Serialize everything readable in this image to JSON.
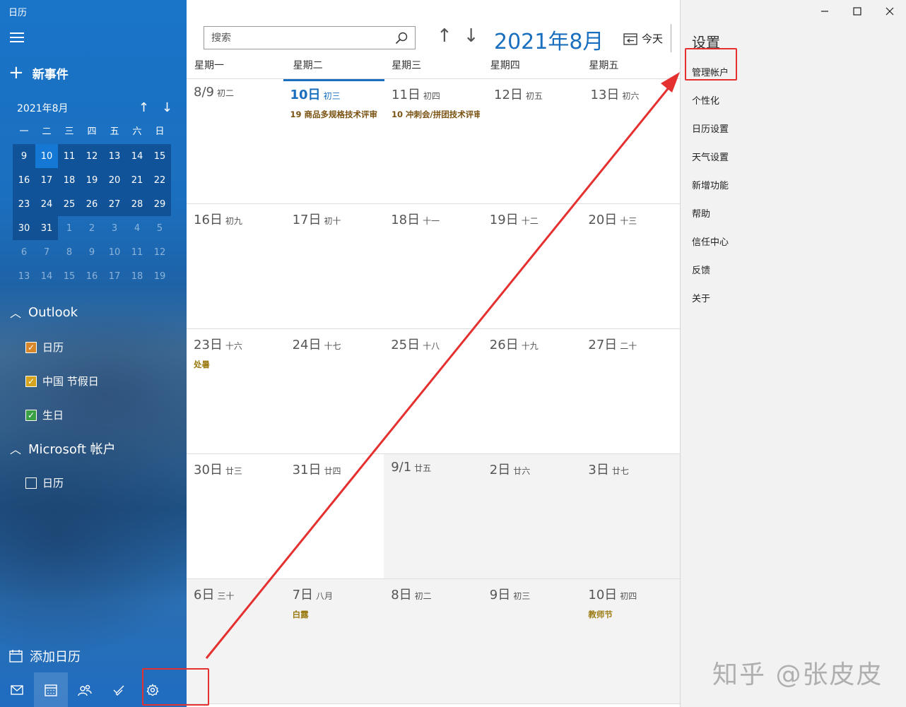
{
  "app": {
    "title": "日历"
  },
  "sidebar": {
    "new_event": "新事件",
    "mini_calendar": {
      "month_label": "2021年8月",
      "dow": [
        "一",
        "二",
        "三",
        "四",
        "五",
        "六",
        "日"
      ],
      "weeks": [
        [
          {
            "d": "9",
            "s": "in"
          },
          {
            "d": "10",
            "s": "today"
          },
          {
            "d": "11",
            "s": "in"
          },
          {
            "d": "12",
            "s": "in"
          },
          {
            "d": "13",
            "s": "in"
          },
          {
            "d": "14",
            "s": "in"
          },
          {
            "d": "15",
            "s": "in"
          }
        ],
        [
          {
            "d": "16",
            "s": "in"
          },
          {
            "d": "17",
            "s": "in"
          },
          {
            "d": "18",
            "s": "in"
          },
          {
            "d": "19",
            "s": "in"
          },
          {
            "d": "20",
            "s": "in"
          },
          {
            "d": "21",
            "s": "in"
          },
          {
            "d": "22",
            "s": "in"
          }
        ],
        [
          {
            "d": "23",
            "s": "in"
          },
          {
            "d": "24",
            "s": "in"
          },
          {
            "d": "25",
            "s": "in"
          },
          {
            "d": "26",
            "s": "in"
          },
          {
            "d": "27",
            "s": "in"
          },
          {
            "d": "28",
            "s": "in"
          },
          {
            "d": "29",
            "s": "in"
          }
        ],
        [
          {
            "d": "30",
            "s": "in"
          },
          {
            "d": "31",
            "s": "in"
          },
          {
            "d": "1",
            "s": "out"
          },
          {
            "d": "2",
            "s": "out"
          },
          {
            "d": "3",
            "s": "out"
          },
          {
            "d": "4",
            "s": "out"
          },
          {
            "d": "5",
            "s": "out"
          }
        ],
        [
          {
            "d": "6",
            "s": "out"
          },
          {
            "d": "7",
            "s": "out"
          },
          {
            "d": "8",
            "s": "out"
          },
          {
            "d": "9",
            "s": "out"
          },
          {
            "d": "10",
            "s": "out"
          },
          {
            "d": "11",
            "s": "out"
          },
          {
            "d": "12",
            "s": "out"
          }
        ],
        [
          {
            "d": "13",
            "s": "out"
          },
          {
            "d": "14",
            "s": "out"
          },
          {
            "d": "15",
            "s": "out"
          },
          {
            "d": "16",
            "s": "out"
          },
          {
            "d": "17",
            "s": "out"
          },
          {
            "d": "18",
            "s": "out"
          },
          {
            "d": "19",
            "s": "out"
          }
        ]
      ]
    },
    "groups": [
      {
        "name": "Outlook",
        "items": [
          {
            "label": "日历",
            "checked": true,
            "color": "orange"
          },
          {
            "label": "中国 节假日",
            "checked": true,
            "color": "yellow"
          },
          {
            "label": "生日",
            "checked": true,
            "color": "green"
          }
        ]
      },
      {
        "name": "Microsoft 帐户",
        "items": [
          {
            "label": "日历",
            "checked": false,
            "color": "none"
          }
        ]
      }
    ],
    "add_calendar": "添加日历",
    "bottom_icons": [
      "mail-icon",
      "calendar-icon",
      "people-icon",
      "todo-icon",
      "settings-icon"
    ]
  },
  "main": {
    "search_placeholder": "搜索",
    "month_title": "2021年8月",
    "today_label": "今天",
    "dow": [
      "星期一",
      "星期二",
      "星期三",
      "星期四",
      "星期五"
    ],
    "weeks": [
      [
        {
          "num": "8/9",
          "lunar": "初二",
          "state": "normal",
          "event": ""
        },
        {
          "num": "10日",
          "lunar": "初三",
          "state": "today",
          "event": "19 商品多规格技术评审"
        },
        {
          "num": "11日",
          "lunar": "初四",
          "state": "normal",
          "event": "10 冲刺会/拼团技术评审"
        },
        {
          "num": "12日",
          "lunar": "初五",
          "state": "normal",
          "event": ""
        },
        {
          "num": "13日",
          "lunar": "初六",
          "state": "normal",
          "event": ""
        }
      ],
      [
        {
          "num": "16日",
          "lunar": "初九",
          "state": "normal",
          "event": ""
        },
        {
          "num": "17日",
          "lunar": "初十",
          "state": "normal",
          "event": ""
        },
        {
          "num": "18日",
          "lunar": "十一",
          "state": "normal",
          "event": ""
        },
        {
          "num": "19日",
          "lunar": "十二",
          "state": "normal",
          "event": ""
        },
        {
          "num": "20日",
          "lunar": "十三",
          "state": "normal",
          "event": ""
        }
      ],
      [
        {
          "num": "23日",
          "lunar": "十六",
          "state": "normal",
          "event": "处暑",
          "holiday": true
        },
        {
          "num": "24日",
          "lunar": "十七",
          "state": "normal",
          "event": ""
        },
        {
          "num": "25日",
          "lunar": "十八",
          "state": "normal",
          "event": ""
        },
        {
          "num": "26日",
          "lunar": "十九",
          "state": "normal",
          "event": ""
        },
        {
          "num": "27日",
          "lunar": "二十",
          "state": "normal",
          "event": ""
        }
      ],
      [
        {
          "num": "30日",
          "lunar": "廿三",
          "state": "normal",
          "event": ""
        },
        {
          "num": "31日",
          "lunar": "廿四",
          "state": "normal",
          "event": ""
        },
        {
          "num": "9/1",
          "lunar": "廿五",
          "state": "gray",
          "event": ""
        },
        {
          "num": "2日",
          "lunar": "廿六",
          "state": "gray",
          "event": ""
        },
        {
          "num": "3日",
          "lunar": "廿七",
          "state": "gray",
          "event": ""
        }
      ],
      [
        {
          "num": "6日",
          "lunar": "三十",
          "state": "gray",
          "event": ""
        },
        {
          "num": "7日",
          "lunar": "八月",
          "state": "gray",
          "event": "白露",
          "holiday": true
        },
        {
          "num": "8日",
          "lunar": "初二",
          "state": "gray",
          "event": ""
        },
        {
          "num": "9日",
          "lunar": "初三",
          "state": "gray",
          "event": ""
        },
        {
          "num": "10日",
          "lunar": "初四",
          "state": "gray",
          "event": "教师节",
          "holiday": true
        }
      ]
    ]
  },
  "settings": {
    "title": "设置",
    "items": [
      "管理帐户",
      "个性化",
      "日历设置",
      "天气设置",
      "新增功能",
      "帮助",
      "信任中心",
      "反馈",
      "关于"
    ]
  },
  "watermark": "知乎 @张皮皮",
  "colors": {
    "accent": "#1a6fbf",
    "annotation": "#e53030"
  }
}
